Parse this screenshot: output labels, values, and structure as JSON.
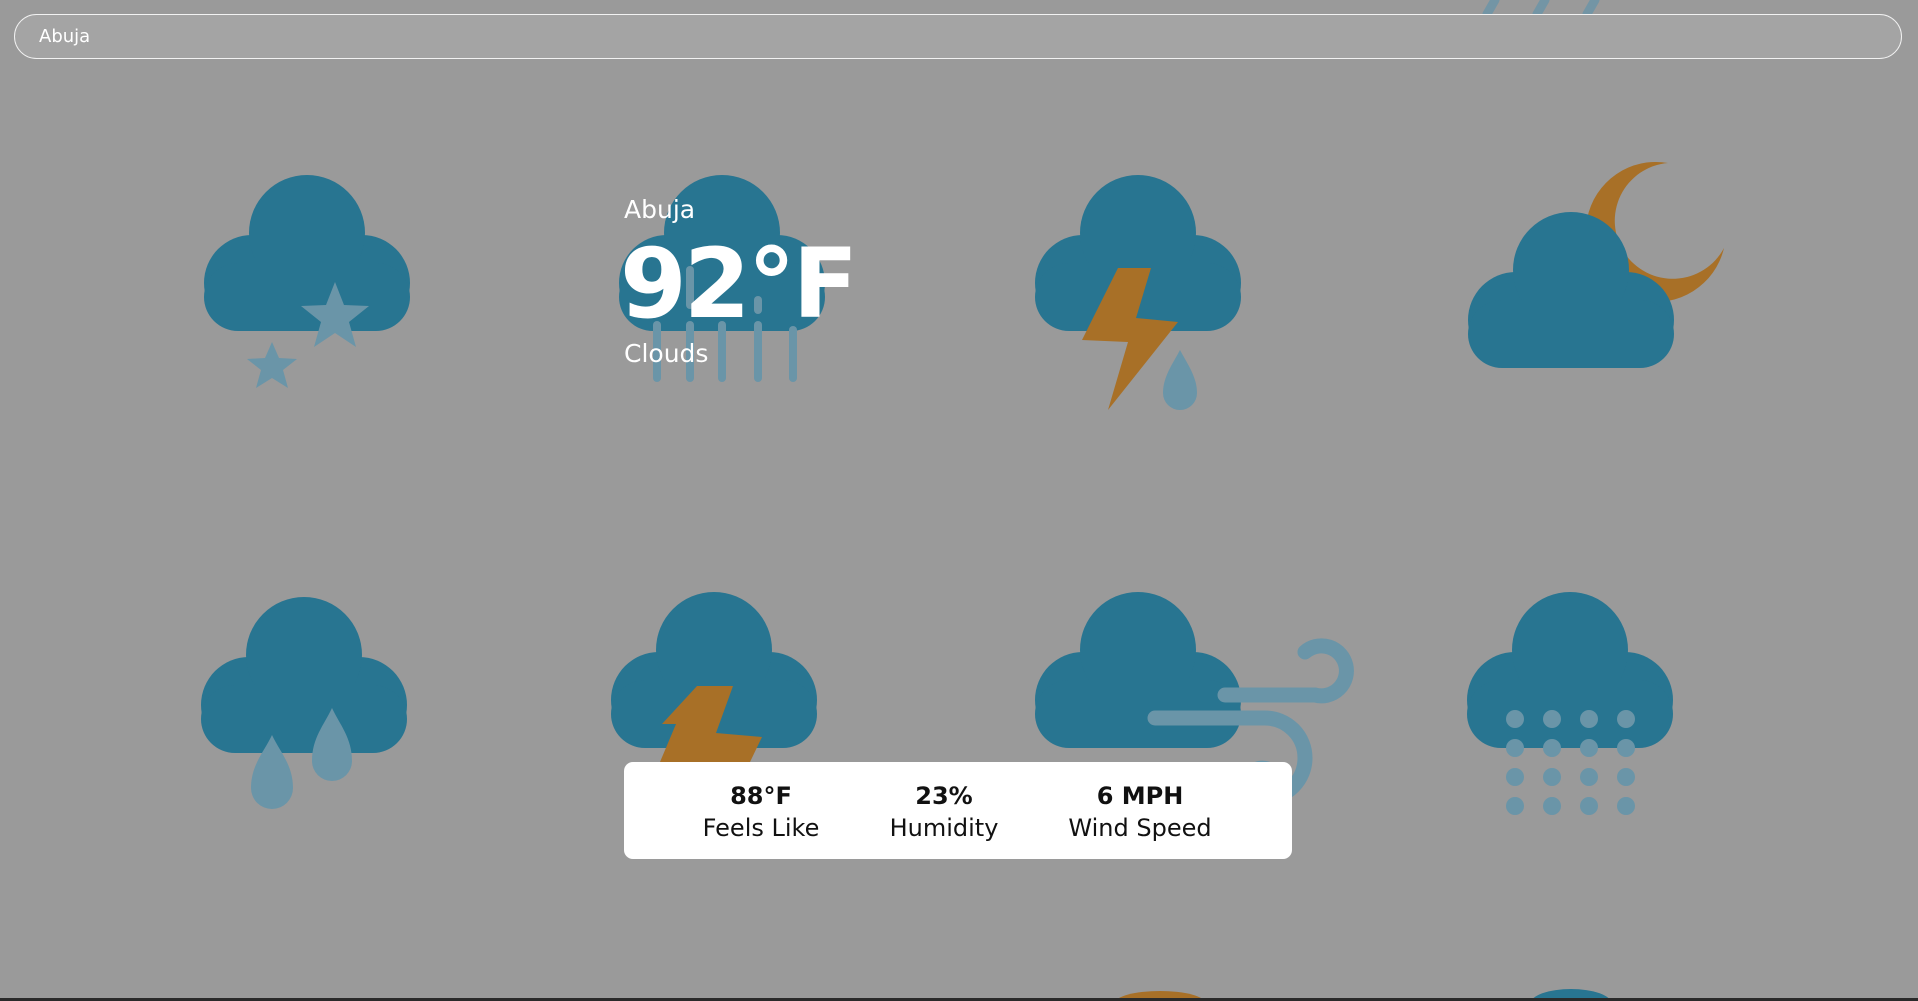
{
  "search": {
    "value": "Abuja"
  },
  "current": {
    "city": "Abuja",
    "temperature": "92°F",
    "condition": "Clouds"
  },
  "details": {
    "feels_like": {
      "value": "88°F",
      "label": "Feels Like"
    },
    "humidity": {
      "value": "23%",
      "label": "Humidity"
    },
    "wind_speed": {
      "value": "6 MPH",
      "label": "Wind Speed"
    }
  },
  "colors": {
    "background": "#9a9a9a",
    "cloud": "#287591",
    "accent_orange": "#a87027",
    "faded_blue": "#6a95a8",
    "card": "#ffffff"
  },
  "background_icons": [
    "cloud-stars-icon",
    "cloud-heavy-rain-icon",
    "cloud-thunder-rain-icon",
    "cloud-moon-icon",
    "cloud-rain-drops-icon",
    "cloud-thunder-icon",
    "cloud-wind-icon",
    "cloud-snow-icon"
  ]
}
